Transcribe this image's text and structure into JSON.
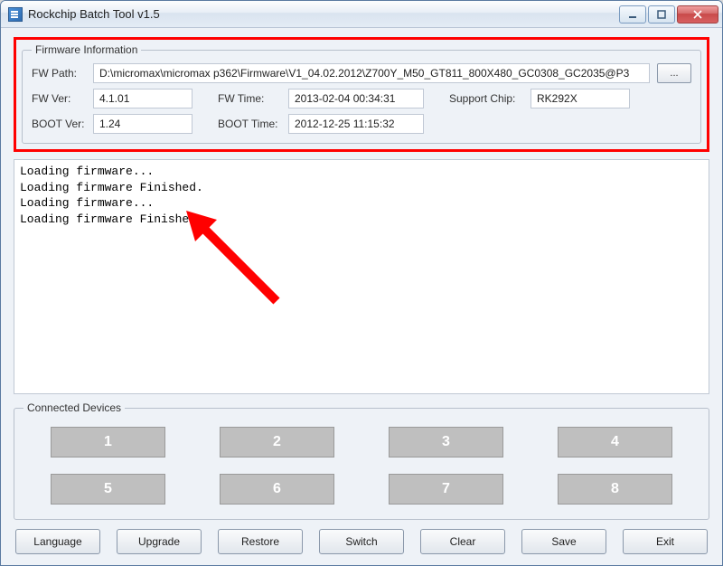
{
  "window": {
    "title": "Rockchip Batch Tool v1.5"
  },
  "firmware": {
    "legend": "Firmware Information",
    "labels": {
      "path": "FW Path:",
      "ver": "FW Ver:",
      "time": "FW Time:",
      "chip": "Support Chip:",
      "bootver": "BOOT Ver:",
      "boottime": "BOOT Time:"
    },
    "values": {
      "path": "D:\\micromax\\micromax p362\\Firmware\\V1_04.02.2012\\Z700Y_M50_GT811_800X480_GC0308_GC2035@P3",
      "ver": "4.1.01",
      "time": "2013-02-04 00:34:31",
      "chip": "RK292X",
      "bootver": "1.24",
      "boottime": "2012-12-25 11:15:32"
    },
    "browse": "..."
  },
  "log": {
    "lines": [
      "Loading firmware...",
      "Loading firmware Finished.",
      "Loading firmware...",
      "Loading firmware Finished."
    ]
  },
  "devices": {
    "legend": "Connected Devices",
    "slots": [
      "1",
      "2",
      "3",
      "4",
      "5",
      "6",
      "7",
      "8"
    ]
  },
  "buttons": {
    "language": "Language",
    "upgrade": "Upgrade",
    "restore": "Restore",
    "switch": "Switch",
    "clear": "Clear",
    "save": "Save",
    "exit": "Exit"
  },
  "colors": {
    "highlight": "#ff0000"
  }
}
